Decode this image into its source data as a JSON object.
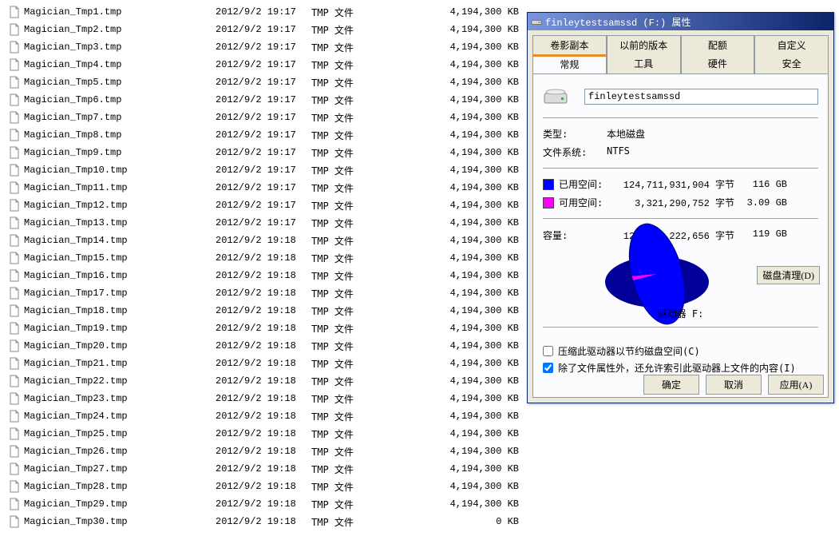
{
  "files": [
    {
      "name": "Magician_Tmp1.tmp",
      "date": "2012/9/2 19:17",
      "type": "TMP 文件",
      "size": "4,194,300 KB"
    },
    {
      "name": "Magician_Tmp2.tmp",
      "date": "2012/9/2 19:17",
      "type": "TMP 文件",
      "size": "4,194,300 KB"
    },
    {
      "name": "Magician_Tmp3.tmp",
      "date": "2012/9/2 19:17",
      "type": "TMP 文件",
      "size": "4,194,300 KB"
    },
    {
      "name": "Magician_Tmp4.tmp",
      "date": "2012/9/2 19:17",
      "type": "TMP 文件",
      "size": "4,194,300 KB"
    },
    {
      "name": "Magician_Tmp5.tmp",
      "date": "2012/9/2 19:17",
      "type": "TMP 文件",
      "size": "4,194,300 KB"
    },
    {
      "name": "Magician_Tmp6.tmp",
      "date": "2012/9/2 19:17",
      "type": "TMP 文件",
      "size": "4,194,300 KB"
    },
    {
      "name": "Magician_Tmp7.tmp",
      "date": "2012/9/2 19:17",
      "type": "TMP 文件",
      "size": "4,194,300 KB"
    },
    {
      "name": "Magician_Tmp8.tmp",
      "date": "2012/9/2 19:17",
      "type": "TMP 文件",
      "size": "4,194,300 KB"
    },
    {
      "name": "Magician_Tmp9.tmp",
      "date": "2012/9/2 19:17",
      "type": "TMP 文件",
      "size": "4,194,300 KB"
    },
    {
      "name": "Magician_Tmp10.tmp",
      "date": "2012/9/2 19:17",
      "type": "TMP 文件",
      "size": "4,194,300 KB"
    },
    {
      "name": "Magician_Tmp11.tmp",
      "date": "2012/9/2 19:17",
      "type": "TMP 文件",
      "size": "4,194,300 KB"
    },
    {
      "name": "Magician_Tmp12.tmp",
      "date": "2012/9/2 19:17",
      "type": "TMP 文件",
      "size": "4,194,300 KB"
    },
    {
      "name": "Magician_Tmp13.tmp",
      "date": "2012/9/2 19:17",
      "type": "TMP 文件",
      "size": "4,194,300 KB"
    },
    {
      "name": "Magician_Tmp14.tmp",
      "date": "2012/9/2 19:18",
      "type": "TMP 文件",
      "size": "4,194,300 KB"
    },
    {
      "name": "Magician_Tmp15.tmp",
      "date": "2012/9/2 19:18",
      "type": "TMP 文件",
      "size": "4,194,300 KB"
    },
    {
      "name": "Magician_Tmp16.tmp",
      "date": "2012/9/2 19:18",
      "type": "TMP 文件",
      "size": "4,194,300 KB"
    },
    {
      "name": "Magician_Tmp17.tmp",
      "date": "2012/9/2 19:18",
      "type": "TMP 文件",
      "size": "4,194,300 KB"
    },
    {
      "name": "Magician_Tmp18.tmp",
      "date": "2012/9/2 19:18",
      "type": "TMP 文件",
      "size": "4,194,300 KB"
    },
    {
      "name": "Magician_Tmp19.tmp",
      "date": "2012/9/2 19:18",
      "type": "TMP 文件",
      "size": "4,194,300 KB"
    },
    {
      "name": "Magician_Tmp20.tmp",
      "date": "2012/9/2 19:18",
      "type": "TMP 文件",
      "size": "4,194,300 KB"
    },
    {
      "name": "Magician_Tmp21.tmp",
      "date": "2012/9/2 19:18",
      "type": "TMP 文件",
      "size": "4,194,300 KB"
    },
    {
      "name": "Magician_Tmp22.tmp",
      "date": "2012/9/2 19:18",
      "type": "TMP 文件",
      "size": "4,194,300 KB"
    },
    {
      "name": "Magician_Tmp23.tmp",
      "date": "2012/9/2 19:18",
      "type": "TMP 文件",
      "size": "4,194,300 KB"
    },
    {
      "name": "Magician_Tmp24.tmp",
      "date": "2012/9/2 19:18",
      "type": "TMP 文件",
      "size": "4,194,300 KB"
    },
    {
      "name": "Magician_Tmp25.tmp",
      "date": "2012/9/2 19:18",
      "type": "TMP 文件",
      "size": "4,194,300 KB"
    },
    {
      "name": "Magician_Tmp26.tmp",
      "date": "2012/9/2 19:18",
      "type": "TMP 文件",
      "size": "4,194,300 KB"
    },
    {
      "name": "Magician_Tmp27.tmp",
      "date": "2012/9/2 19:18",
      "type": "TMP 文件",
      "size": "4,194,300 KB"
    },
    {
      "name": "Magician_Tmp28.tmp",
      "date": "2012/9/2 19:18",
      "type": "TMP 文件",
      "size": "4,194,300 KB"
    },
    {
      "name": "Magician_Tmp29.tmp",
      "date": "2012/9/2 19:18",
      "type": "TMP 文件",
      "size": "4,194,300 KB"
    },
    {
      "name": "Magician_Tmp30.tmp",
      "date": "2012/9/2 19:18",
      "type": "TMP 文件",
      "size": "0 KB"
    }
  ],
  "props": {
    "title": "finleytestsamssd (F:) 属性",
    "tabs_row1": [
      "卷影副本",
      "以前的版本",
      "配额",
      "自定义"
    ],
    "tabs_row2": [
      "常规",
      "工具",
      "硬件",
      "安全"
    ],
    "active_tab": "常规",
    "drive_label": "finleytestsamssd",
    "type_label": "类型:",
    "type_value": "本地磁盘",
    "fs_label": "文件系统:",
    "fs_value": "NTFS",
    "used_label": "已用空间:",
    "used_bytes": "124,711,931,904 字节",
    "used_human": "116 GB",
    "free_label": "可用空间:",
    "free_bytes": "3,321,290,752 字节",
    "free_human": "3.09 GB",
    "capacity_label": "容量:",
    "capacity_bytes": "128,033,222,656 字节",
    "capacity_human": "119 GB",
    "drive_letter": "驱动器 F:",
    "cleanup_btn": "磁盘清理(D)",
    "compress_label": "压缩此驱动器以节约磁盘空间(C)",
    "index_label": "除了文件属性外，还允许索引此驱动器上文件的内容(I)",
    "compress_checked": false,
    "index_checked": true,
    "ok_btn": "确定",
    "cancel_btn": "取消",
    "apply_btn": "应用(A)"
  },
  "chart_data": {
    "type": "pie",
    "title": "驱动器 F:",
    "series": [
      {
        "name": "已用空间",
        "value": 124711931904,
        "human": "116 GB",
        "color": "#0000ff"
      },
      {
        "name": "可用空间",
        "value": 3321290752,
        "human": "3.09 GB",
        "color": "#ff00ff"
      }
    ],
    "total": {
      "name": "容量",
      "value": 128033222656,
      "human": "119 GB"
    }
  }
}
